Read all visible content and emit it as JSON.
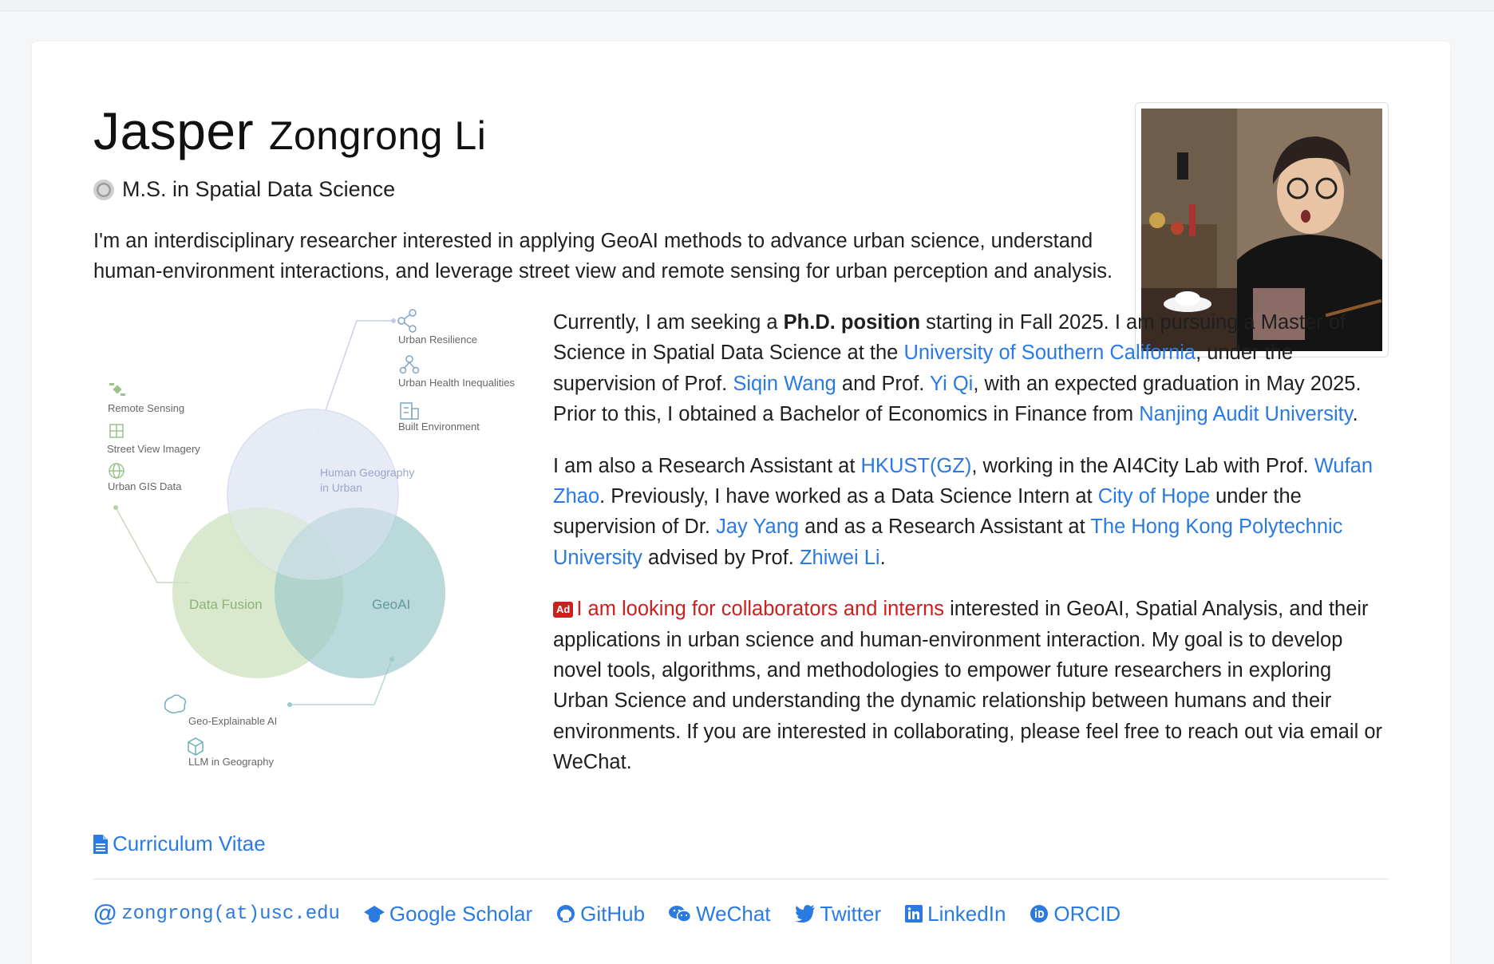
{
  "profile": {
    "first_name": "Jasper",
    "rest_name": "Zongrong Li",
    "degree": "M.S. in Spatial Data Science",
    "intro": "I'm an interdisciplinary researcher interested in applying GeoAI methods to advance urban science, understand human-environment interactions, and leverage street view and remote sensing for urban perception and analysis."
  },
  "bio": {
    "p1": {
      "t1": "Currently, I am seeking a ",
      "strong": "Ph.D. position",
      "t2": " starting in Fall 2025. I am pursuing a Master of Science in Spatial Data Science at the ",
      "usc": "University of Southern California",
      "t3": ", under the supervision of Prof. ",
      "wang": "Siqin Wang",
      "t4": " and Prof. ",
      "qi": "Yi Qi",
      "t5": ", with an expected graduation in May 2025. Prior to this, I obtained a Bachelor of Economics in Finance from ",
      "nau": "Nanjing Audit University",
      "t6": "."
    },
    "p2": {
      "t1": "I am also a Research Assistant at ",
      "hkust": "HKUST(GZ)",
      "t2": ", working in the AI4City Lab with Prof. ",
      "zhao": "Wufan Zhao",
      "t3": ". Previously, I have worked as a Data Science Intern at ",
      "hope": "City of Hope",
      "t4": " under the supervision of Dr. ",
      "yang": "Jay Yang",
      "t5": " and as a Research Assistant at ",
      "polyu": "The Hong Kong Polytechnic University",
      "t6": " advised by Prof. ",
      "li": "Zhiwei Li",
      "t7": "."
    },
    "p3": {
      "badge": "Ad",
      "highlight": "I am looking for collaborators and interns",
      "text": " interested in GeoAI, Spatial Analysis, and their applications in urban science and human-environment interaction. My goal is to develop novel tools, algorithms, and methodologies to empower future researchers in exploring Urban Science and understanding the dynamic relationship between humans and their environments. If you are interested in collaborating, please feel free to reach out via email or WeChat."
    }
  },
  "venn": {
    "circle_top": [
      "Human Geography",
      "in Urban"
    ],
    "circle_left": "Data Fusion",
    "circle_right": "GeoAI",
    "left_items": [
      "Remote Sensing",
      "Street View Imagery",
      "Urban GIS Data"
    ],
    "top_items": [
      "Urban Resilience",
      "Urban Health Inequalities",
      "Built Environment"
    ],
    "bottom_items": [
      "Geo-Explainable AI",
      "LLM in Geography"
    ]
  },
  "cv_label": "Curriculum Vitae",
  "links": {
    "email": "zongrong(at)usc.edu",
    "scholar": "Google Scholar",
    "github": "GitHub",
    "wechat": "WeChat",
    "twitter": "Twitter",
    "linkedin": "LinkedIn",
    "orcid": "ORCID"
  },
  "colors": {
    "link": "#2a7ae2",
    "highlight": "#cc1f1f",
    "venn_blue": "#e6eaf6",
    "venn_green": "#cfe3c0",
    "venn_teal": "#9fcbcc"
  },
  "icons": [
    "university-seal-icon",
    "file-icon",
    "at-icon",
    "graduation-cap-icon",
    "github-icon",
    "wechat-icon",
    "twitter-icon",
    "linkedin-icon",
    "orcid-icon",
    "share-icon",
    "people-icon",
    "building-icon",
    "satellite-icon",
    "grid-icon",
    "globe-icon",
    "brain-icon",
    "cube-icon"
  ]
}
